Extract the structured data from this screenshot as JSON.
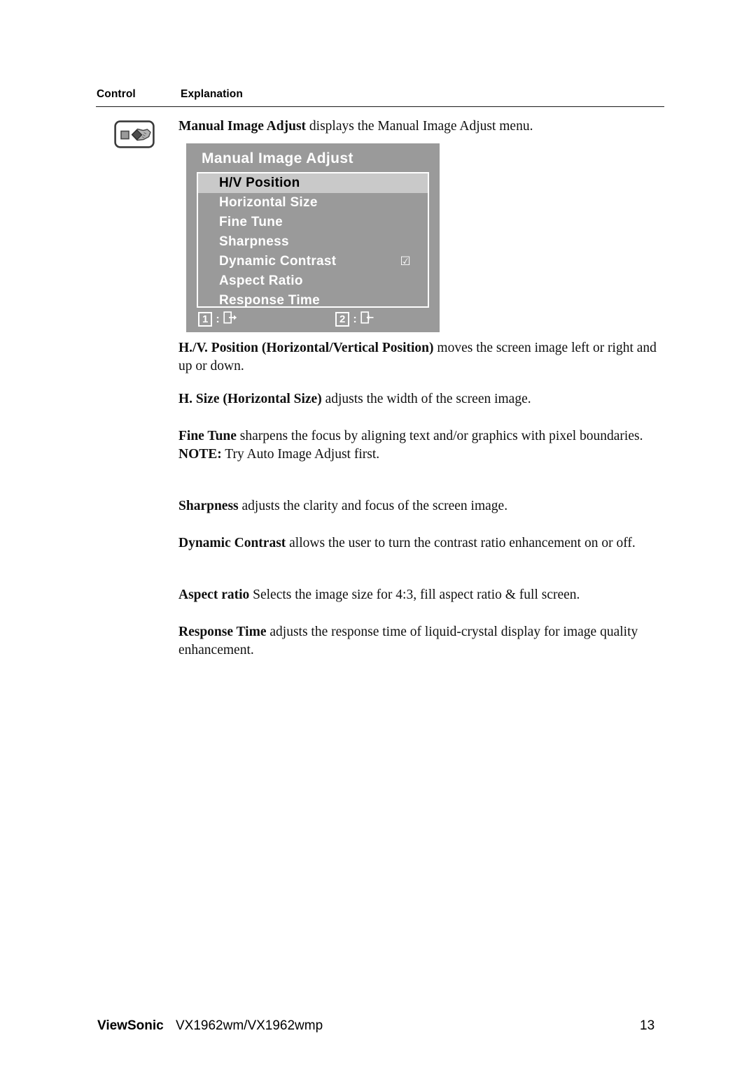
{
  "table_header": {
    "control": "Control",
    "explanation": "Explanation"
  },
  "control_icon": {
    "name": "manual-image-adjust-icon"
  },
  "paragraphs": {
    "intro": {
      "lead": "Manual Image Adjust",
      "body": " displays the Manual Image Adjust menu."
    },
    "hv_position": {
      "lead": "H./V. Position (Horizontal/Vertical Position)",
      "body": " moves the screen image left or right and up or down."
    },
    "h_size": {
      "lead": "H. Size (Horizontal Size)",
      "body": " adjusts the width of the screen image."
    },
    "fine_tune": {
      "lead": "Fine Tune",
      "body": " sharpens the focus by aligning text and/or graphics with pixel boundaries.",
      "note_lead": "NOTE:",
      "note_body": " Try Auto Image Adjust first."
    },
    "sharpness": {
      "lead": "Sharpness",
      "body": " adjusts the clarity and focus of the screen image."
    },
    "dynamic_contrast": {
      "lead": "Dynamic Contrast",
      "body": " allows the user to turn the contrast ratio enhancement on or off."
    },
    "aspect_ratio": {
      "lead": "Aspect ratio",
      "body": " Selects the image size for 4:3, fill aspect ratio & full screen."
    },
    "response_time": {
      "lead": "Response Time",
      "body": " adjusts the response time of liquid-crystal display for image quality enhancement."
    }
  },
  "osd": {
    "title": "Manual Image Adjust",
    "items": [
      {
        "label": "H/V Position",
        "selected": true,
        "checkbox": ""
      },
      {
        "label": "Horizontal Size",
        "selected": false,
        "checkbox": ""
      },
      {
        "label": "Fine Tune",
        "selected": false,
        "checkbox": ""
      },
      {
        "label": "Sharpness",
        "selected": false,
        "checkbox": ""
      },
      {
        "label": "Dynamic Contrast",
        "selected": false,
        "checkbox": "☑"
      },
      {
        "label": "Aspect Ratio",
        "selected": false,
        "checkbox": ""
      },
      {
        "label": "Response Time",
        "selected": false,
        "checkbox": ""
      }
    ],
    "footer": [
      {
        "key": "1",
        "sep": ":",
        "icon": "exit-right-icon"
      },
      {
        "key": "2",
        "sep": ":",
        "icon": "enter-left-icon"
      }
    ],
    "colors": {
      "panel": "#9a9a9a",
      "selected_row": "#c9c9c9",
      "text": "#ffffff",
      "selected_text": "#000000"
    }
  },
  "footer": {
    "brand": "ViewSonic",
    "model": "VX1962wm/VX1962wmp",
    "page": "13"
  }
}
